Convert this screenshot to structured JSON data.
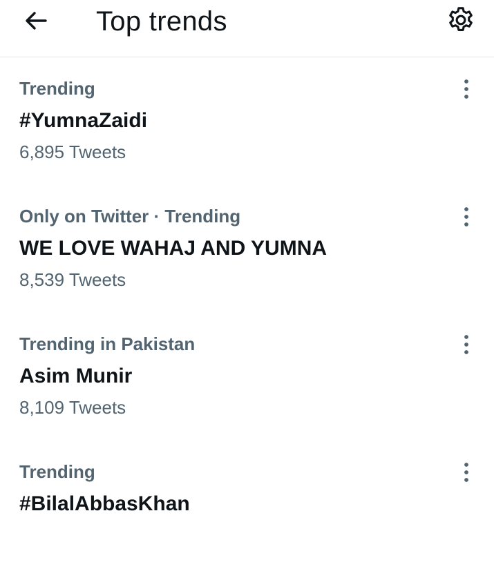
{
  "header": {
    "title": "Top trends",
    "back_icon": "arrow-left-icon",
    "settings_icon": "gear-icon"
  },
  "trends": [
    {
      "context": "Trending",
      "name": "#YumnaZaidi",
      "count": "6,895 Tweets"
    },
    {
      "context": "Only on Twitter · Trending",
      "name": "WE LOVE WAHAJ AND YUMNA",
      "count": "8,539 Tweets"
    },
    {
      "context": "Trending in Pakistan",
      "name": "Asim Munir",
      "count": "8,109 Tweets"
    },
    {
      "context": "Trending",
      "name": "#BilalAbbasKhan",
      "count": ""
    }
  ],
  "colors": {
    "primary_text": "#0f1419",
    "secondary_text": "#536471",
    "divider": "#e3e6e8"
  }
}
